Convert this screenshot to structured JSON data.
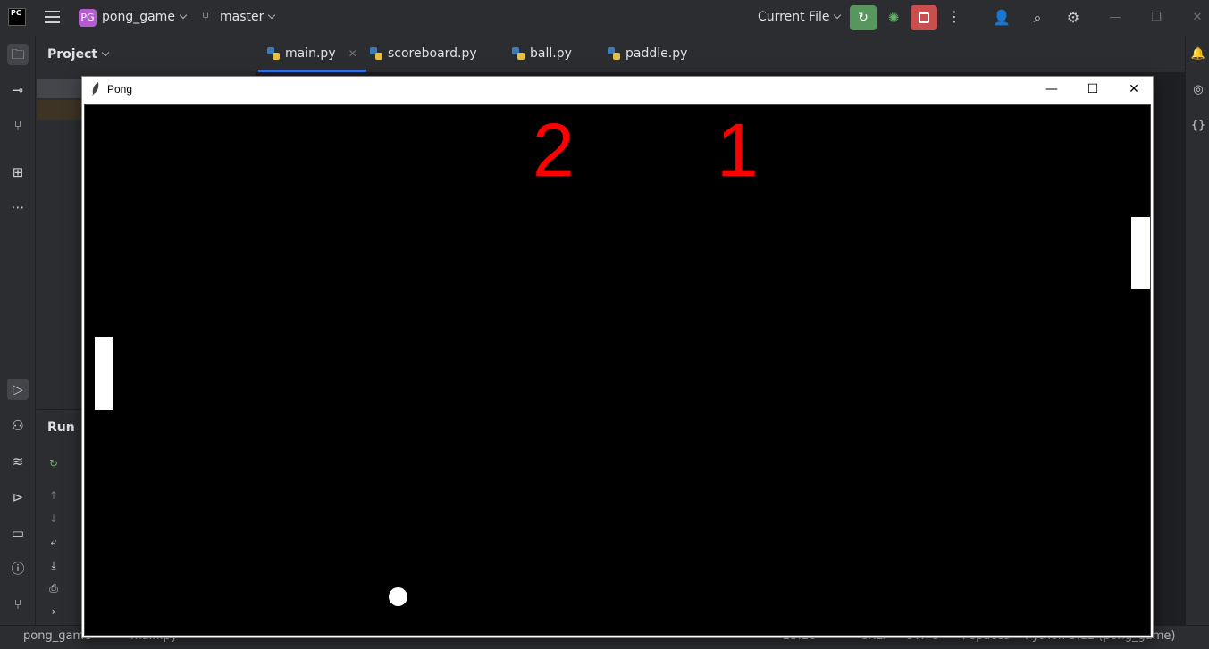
{
  "ide": {
    "logo_text": "PC",
    "project_badge": "PG",
    "project_name": "pong_game",
    "branch": "master",
    "run_config": "Current File"
  },
  "project_pane": {
    "title": "Project"
  },
  "run_pane": {
    "title": "Run"
  },
  "tabs": [
    {
      "label": "main.py",
      "active": true
    },
    {
      "label": "scoreboard.py",
      "active": false
    },
    {
      "label": "ball.py",
      "active": false
    },
    {
      "label": "paddle.py",
      "active": false
    }
  ],
  "statusbar": {
    "project": "pong_game",
    "file": "main.py",
    "position": "23:26",
    "line_ending": "CRLF",
    "encoding": "UTF-8",
    "indent": "4 spaces",
    "interpreter": "Python 3.12 (pong_game)"
  },
  "pong": {
    "window_title": "Pong",
    "left_score": "2",
    "right_score": "1",
    "score_color": "#ff0000",
    "background_color": "#000000"
  },
  "icons": {
    "minimize": "—",
    "maximize": "☐",
    "close": "✕"
  }
}
